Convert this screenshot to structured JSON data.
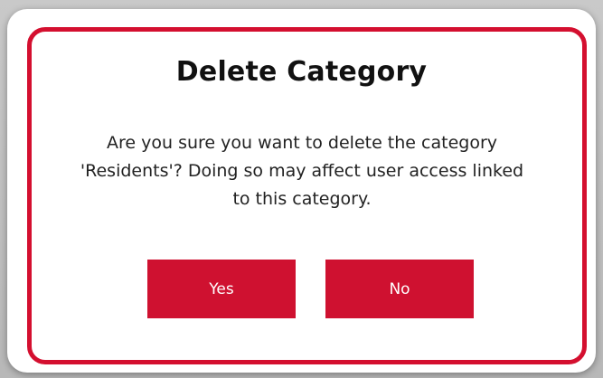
{
  "dialog": {
    "title": "Delete Category",
    "message": "Are you sure you want to delete the category 'Residents'? Doing so may affect user access linked to this category.",
    "buttons": {
      "yes_label": "Yes",
      "no_label": "No"
    }
  },
  "colors": {
    "accent": "#d40f2f",
    "button": "#cf1130",
    "button_text": "#ffffff",
    "title_text": "#111111"
  }
}
